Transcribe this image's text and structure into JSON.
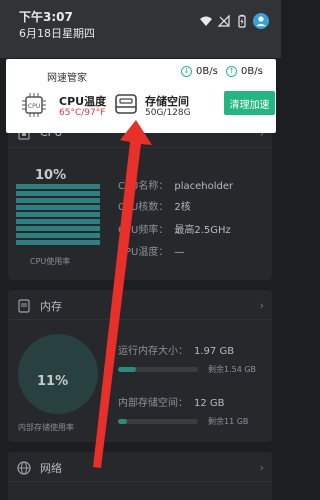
{
  "status": {
    "time": "下午3:07",
    "date": "6月18日星期四"
  },
  "notification": {
    "app_name": "网速管家",
    "download_speed": "0B/s",
    "upload_speed": "0B/s",
    "cpu_title": "CPU温度",
    "cpu_value": "65°C/97°F",
    "storage_title": "存储空间",
    "storage_value": "50G/128G",
    "clean_button": "清理加速"
  },
  "cpu_panel": {
    "title": "CPU",
    "usage_percent": "10%",
    "usage_caption": "CPU使用率",
    "rows": [
      {
        "label": "CPU名称：",
        "value": "placeholder"
      },
      {
        "label": "CPU核数：",
        "value": "2核"
      },
      {
        "label": "CPU频率：",
        "value": "最高2.5GHz"
      },
      {
        "label": "CPU温度：",
        "value": "—"
      }
    ]
  },
  "memory_panel": {
    "title": "内存",
    "usage_percent": "11%",
    "usage_caption": "内部存储使用率",
    "ram_label": "运行内存大小：",
    "ram_value": "1.97 GB",
    "ram_remaining": "剩余1.54 GB",
    "ram_fill": 0.22,
    "storage_label": "内部存储空间：",
    "storage_value": "12 GB",
    "storage_remaining": "剩余11 GB",
    "storage_fill": 0.11
  },
  "network_panel": {
    "title": "网络"
  },
  "colors": {
    "accent": "#24b582",
    "warning": "#e0353b",
    "annotation_arrow": "#e8302a"
  }
}
